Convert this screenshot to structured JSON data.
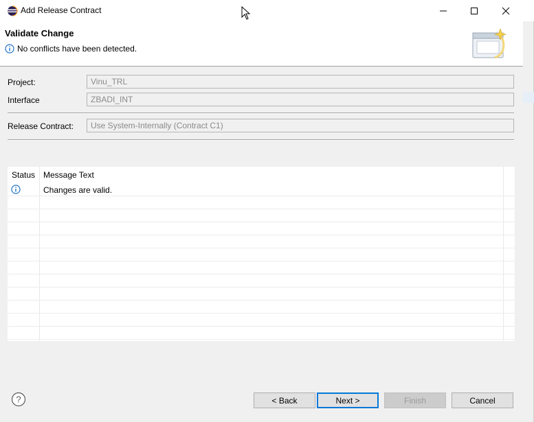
{
  "window": {
    "title": "Add Release Contract"
  },
  "header": {
    "title": "Validate Change",
    "message": "No conflicts have been detected."
  },
  "form": {
    "project_label": "Project:",
    "project_value": "Vinu_TRL",
    "interface_label": "Interface",
    "interface_value": "ZBADI_INT",
    "contract_label": "Release Contract:",
    "contract_value": "Use System-Internally (Contract C1)"
  },
  "table": {
    "columns": [
      "Status",
      "Message Text"
    ],
    "rows": [
      {
        "status_icon": "info-icon",
        "message": "Changes are valid."
      }
    ]
  },
  "footer": {
    "back_label": "< Back",
    "next_label": "Next >",
    "finish_label": "Finish",
    "cancel_label": "Cancel"
  },
  "colors": {
    "info_blue": "#1f6fc5",
    "default_button_border": "#0078d7"
  }
}
